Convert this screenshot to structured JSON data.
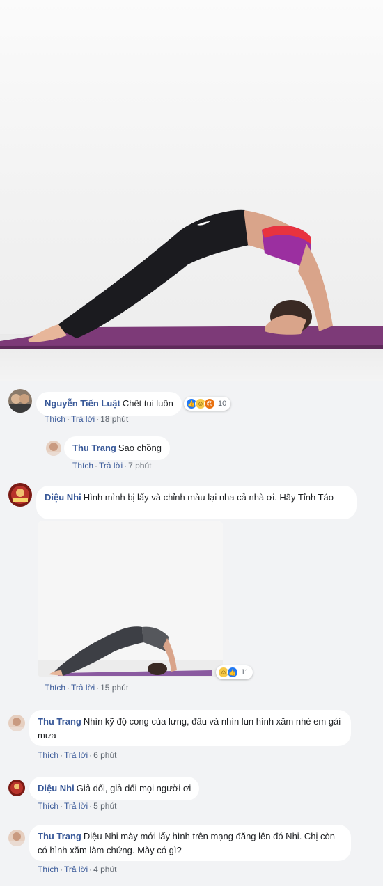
{
  "photo": {
    "alt": "yoga-pose-photo"
  },
  "comments": [
    {
      "author": "Nguyễn Tiến Luật",
      "text": "Chết tui luôn",
      "actions": {
        "like": "Thích",
        "reply": "Trả lời",
        "time": "18 phút"
      },
      "reactions": {
        "icons": [
          "like-icon",
          "haha-icon",
          "angry-icon"
        ],
        "count": "10"
      }
    },
    {
      "author": "Thu Trang",
      "text": "Sao chồng",
      "actions": {
        "like": "Thích",
        "reply": "Trả lời",
        "time": "7 phút"
      }
    },
    {
      "author": "Diệu Nhi",
      "text": "Hình mình bị lấy và chỉnh màu lại nha cả nhà ơi. Hãy Tỉnh Táo",
      "actions": {
        "like": "Thích",
        "reply": "Trả lời",
        "time": "15 phút"
      },
      "reactions": {
        "icons": [
          "haha-icon",
          "like-icon"
        ],
        "count": "11"
      }
    },
    {
      "author": "Thu Trang",
      "text": "Nhìn kỹ độ cong của lưng, đầu và nhìn lun hình xăm nhé em gái mưa",
      "actions": {
        "like": "Thích",
        "reply": "Trả lời",
        "time": "6 phút"
      }
    },
    {
      "author": "Diệu Nhi",
      "text": "Giả dối, giả dối mọi người ơi",
      "actions": {
        "like": "Thích",
        "reply": "Trả lời",
        "time": "5 phút"
      }
    },
    {
      "author": "Thu Trang",
      "text": "Diệu Nhi mày mới lấy hình trên mạng đăng lên đó Nhi. Chị còn có hình xăm làm chứng. Mày có gì?",
      "actions": {
        "like": "Thích",
        "reply": "Trả lời",
        "time": "4 phút"
      }
    }
  ],
  "colors": {
    "author": "#385898",
    "bubble": "#ffffff",
    "background": "#f2f3f5",
    "mat": "#7d3a78"
  }
}
